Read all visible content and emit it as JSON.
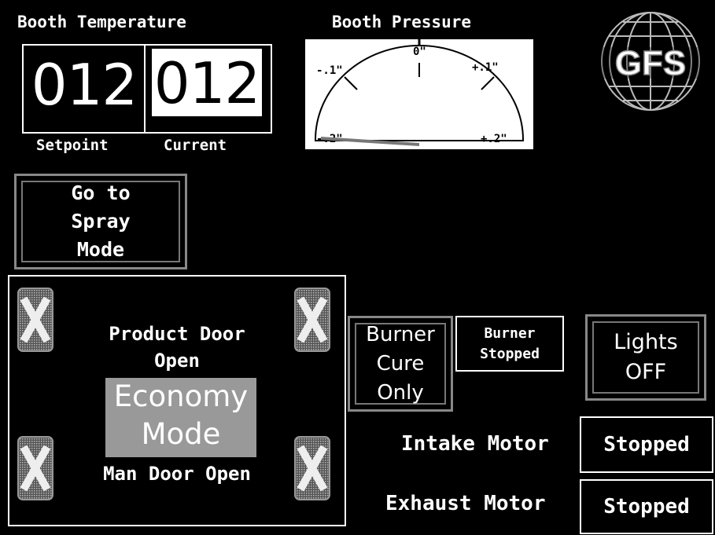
{
  "temperature": {
    "title": "Booth Temperature",
    "setpoint_value": "012",
    "current_value": "012",
    "setpoint_label": "Setpoint",
    "current_label": "Current"
  },
  "pressure": {
    "title": "Booth Pressure",
    "tick_labels": [
      "-.2\"",
      "-.1\"",
      "0\"",
      "+.1\"",
      "+.2\""
    ],
    "reading": -0.2
  },
  "logo": {
    "text": "GFS",
    "icon": "globe-logo-icon"
  },
  "spray_button": {
    "label": "Go to\nSpray\nMode"
  },
  "door_panel": {
    "product_door": "Product Door\nOpen",
    "economy_mode": "Economy\nMode",
    "man_door": "Man Door Open",
    "x_icon": "x-mark-icon"
  },
  "burner": {
    "button_label": "Burner\nCure\nOnly",
    "status": "Burner\nStopped"
  },
  "lights": {
    "label": "Lights\nOFF"
  },
  "motors": {
    "intake_label": "Intake Motor",
    "intake_status": "Stopped",
    "exhaust_label": "Exhaust Motor",
    "exhaust_status": "Stopped"
  },
  "colors": {
    "background": "#000000",
    "foreground": "#ffffff",
    "highlight": "#999999",
    "button_border": "#888888"
  }
}
